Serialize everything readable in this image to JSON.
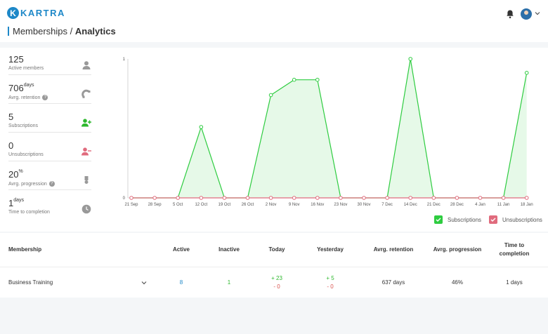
{
  "app": {
    "logo_letter": "K",
    "logo_text": "KARTRA"
  },
  "breadcrumb": {
    "parent": "Memberships",
    "separator": " / ",
    "current": "Analytics"
  },
  "stats": [
    {
      "value": "125",
      "unit": "",
      "label": "Active members",
      "icon": "user-icon",
      "help": false
    },
    {
      "value": "706",
      "unit": "days",
      "label": "Avrg. retention",
      "icon": "magnet-icon",
      "help": true
    },
    {
      "value": "5",
      "unit": "",
      "label": "Subscriptions",
      "icon": "user-add-icon",
      "help": false
    },
    {
      "value": "0",
      "unit": "",
      "label": "Unsubscriptions",
      "icon": "user-remove-icon",
      "help": false
    },
    {
      "value": "20",
      "unit": "%",
      "label": "Avrg. progression",
      "icon": "award-icon",
      "help": true
    },
    {
      "value": "1",
      "unit": "days",
      "label": "Time to completion",
      "icon": "clock-icon",
      "help": false
    }
  ],
  "chart_data": {
    "type": "area",
    "x": [
      "21 Sep",
      "28 Sep",
      "5 Oct",
      "12 Oct",
      "19 Oct",
      "26 Oct",
      "2 Nov",
      "9 Nov",
      "16 Nov",
      "23 Nov",
      "30 Nov",
      "7 Dec",
      "14 Dec",
      "21 Dec",
      "28 Dec",
      "4 Jan",
      "11 Jan",
      "18 Jan"
    ],
    "series": [
      {
        "name": "Subscriptions",
        "color": "#2ecc40",
        "values": [
          0,
          0,
          0,
          0.51,
          0,
          0,
          0.74,
          0.85,
          0.85,
          0,
          0,
          0,
          1,
          0,
          0,
          0,
          0,
          0.9
        ]
      },
      {
        "name": "Unsubscriptions",
        "color": "#e06b7d",
        "values": [
          0,
          0,
          0,
          0,
          0,
          0,
          0,
          0,
          0,
          0,
          0,
          0,
          0,
          0,
          0,
          0,
          0,
          0
        ]
      }
    ],
    "yticks": [
      "0",
      "1"
    ],
    "ylim": [
      0,
      1
    ],
    "legend": "bottom-right",
    "grid": false
  },
  "table": {
    "headers": [
      "Membership",
      "Active",
      "Inactive",
      "Today",
      "Yesterday",
      "Avrg. retention",
      "Avrg. progression",
      "Time to completion"
    ],
    "rows": [
      {
        "name": "Business Training",
        "active": "8",
        "inactive": "1",
        "today_plus": "+ 23",
        "today_minus": "- 0",
        "yesterday_plus": "+ 5",
        "yesterday_minus": "- 0",
        "retention": "637 days",
        "progression": "46%",
        "completion": "1 days"
      }
    ]
  }
}
